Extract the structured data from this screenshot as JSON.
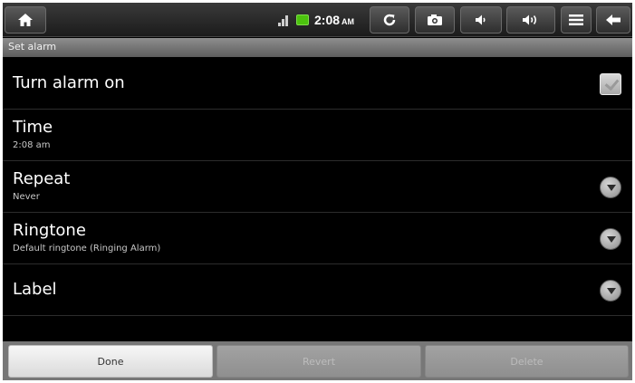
{
  "statusbar": {
    "time": "2:08",
    "ampm": "AM",
    "icons": [
      "home-icon",
      "wifi-signal-icon",
      "battery-icon",
      "refresh-icon",
      "camera-icon",
      "volume-down-icon",
      "volume-up-icon",
      "menu-icon",
      "back-arrow-icon"
    ]
  },
  "header": {
    "title": "Set alarm"
  },
  "settings": {
    "alarm_on": {
      "label": "Turn alarm on",
      "checked": true
    },
    "time": {
      "label": "Time",
      "value": "2:08 am"
    },
    "repeat": {
      "label": "Repeat",
      "value": "Never"
    },
    "ringtone": {
      "label": "Ringtone",
      "value": "Default ringtone (Ringing Alarm)"
    },
    "label": {
      "label": "Label"
    }
  },
  "buttons": {
    "done": "Done",
    "revert": "Revert",
    "delete": "Delete"
  },
  "colors": {
    "battery": "#4cc20e",
    "background": "#000000",
    "title_strip": "#7a7a7a"
  }
}
